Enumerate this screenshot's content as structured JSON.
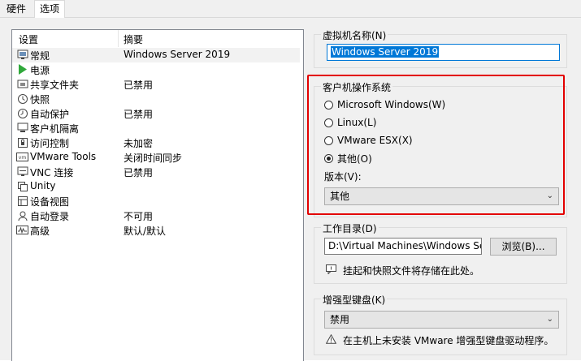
{
  "tabs": [
    {
      "label": "硬件"
    },
    {
      "label": "选项"
    }
  ],
  "settings_list": {
    "col_settings": "设置",
    "col_summary": "摘要",
    "rows": [
      {
        "name": "常规",
        "summary": "Windows Server 2019",
        "icon": "general-icon"
      },
      {
        "name": "电源",
        "summary": "",
        "icon": "power-play-icon"
      },
      {
        "name": "共享文件夹",
        "summary": "已禁用",
        "icon": "shared-folder-icon"
      },
      {
        "name": "快照",
        "summary": "",
        "icon": "snapshot-icon"
      },
      {
        "name": "自动保护",
        "summary": "已禁用",
        "icon": "autoprotect-icon"
      },
      {
        "name": "客户机隔离",
        "summary": "",
        "icon": "isolation-icon"
      },
      {
        "name": "访问控制",
        "summary": "未加密",
        "icon": "access-control-icon"
      },
      {
        "name": "VMware Tools",
        "summary": "关闭时间同步",
        "icon": "vmware-tools-icon"
      },
      {
        "name": "VNC 连接",
        "summary": "已禁用",
        "icon": "vnc-icon"
      },
      {
        "name": "Unity",
        "summary": "",
        "icon": "unity-icon"
      },
      {
        "name": "设备视图",
        "summary": "",
        "icon": "device-view-icon"
      },
      {
        "name": "自动登录",
        "summary": "不可用",
        "icon": "autologin-icon"
      },
      {
        "name": "高级",
        "summary": "默认/默认",
        "icon": "advanced-icon"
      }
    ]
  },
  "vm_name": {
    "label": "虚拟机名称(N)",
    "value": "Windows Server 2019"
  },
  "guest_os": {
    "label": "客户机操作系统",
    "options": [
      {
        "label": "Microsoft Windows(W)",
        "checked": false
      },
      {
        "label": "Linux(L)",
        "checked": false
      },
      {
        "label": "VMware ESX(X)",
        "checked": false
      },
      {
        "label": "其他(O)",
        "checked": true
      }
    ],
    "version_label": "版本(V):",
    "version_value": "其他"
  },
  "working_dir": {
    "label": "工作目录(D)",
    "value": "D:\\Virtual Machines\\Windows Serv",
    "browse_label": "浏览(B)...",
    "hint": "挂起和快照文件将存储在此处。"
  },
  "enhanced_keyboard": {
    "label": "增强型键盘(K)",
    "value": "禁用",
    "warning": "在主机上未安装 VMware 增强型键盘驱动程序。"
  },
  "colors": {
    "highlight_border": "#e30000",
    "selection": "#0078d7"
  }
}
